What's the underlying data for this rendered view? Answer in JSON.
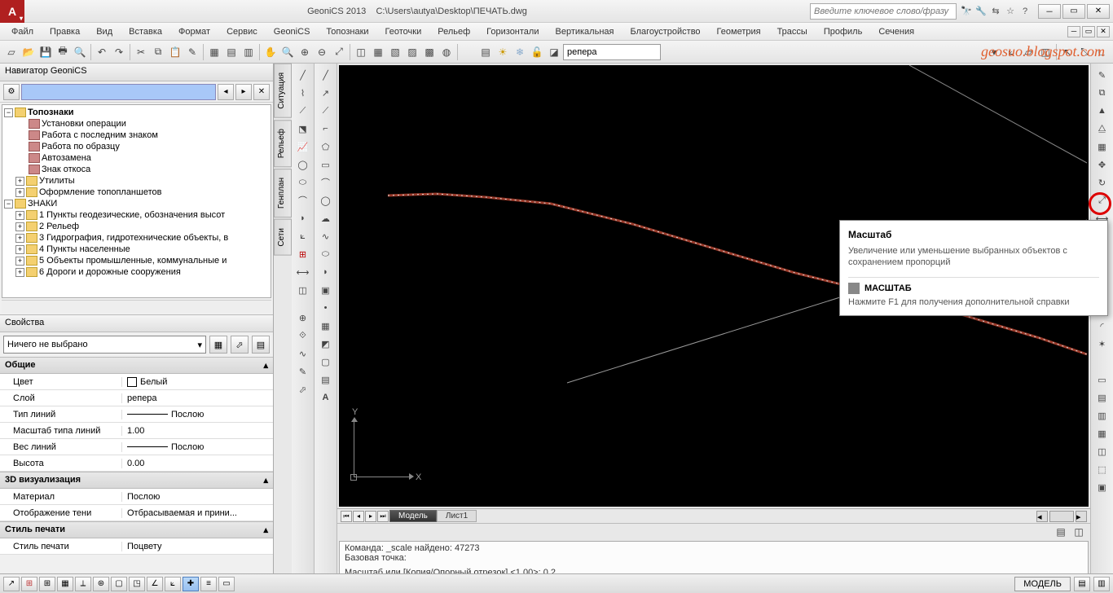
{
  "title": {
    "app": "GeoniCS 2013",
    "file": "C:\\Users\\autya\\Desktop\\ПЕЧАТЬ.dwg"
  },
  "search_placeholder": "Введите ключевое слово/фразу",
  "watermark": "geosuo.blogspot.com",
  "menu": [
    "Файл",
    "Правка",
    "Вид",
    "Вставка",
    "Формат",
    "Сервис",
    "GeoniCS",
    "Топознаки",
    "Геоточки",
    "Рельеф",
    "Горизонтали",
    "Вертикальная",
    "Благоустройство",
    "Геометрия",
    "Трассы",
    "Профиль",
    "Сечения"
  ],
  "layer_name": "репера",
  "navigator": {
    "title": "Навигатор GeoniCS",
    "tree": {
      "root": "Топознаки",
      "items": [
        "Установки операции",
        "Работа с последним знаком",
        "Работа по образцу",
        "Автозамена",
        "Знак откоса"
      ],
      "folders": [
        "Утилиты",
        "Оформление топопланшетов"
      ],
      "znaki": "ЗНАКИ",
      "znaki_items": [
        "1 Пункты геодезические, обозначения высот",
        "2 Рельеф",
        "3 Гидрография, гидротехнические объекты, в",
        "4 Пункты населенные",
        "5 Объекты промышленные, коммунальные и",
        "6 Дороги и дорожные сооружения"
      ]
    }
  },
  "vtabs": [
    "Ситуация",
    "Рельеф",
    "Генплан",
    "Сети"
  ],
  "properties": {
    "title": "Свойства",
    "selection": "Ничего не выбрано",
    "sections": {
      "general": "Общие",
      "viz3d": "3D визуализация",
      "print": "Стиль печати"
    },
    "rows": {
      "color_k": "Цвет",
      "color_v": "Белый",
      "layer_k": "Слой",
      "layer_v": "репера",
      "ltype_k": "Тип линий",
      "ltype_v": "Послою",
      "lscale_k": "Масштаб типа линий",
      "lscale_v": "1.00",
      "lweight_k": "Вес линий",
      "lweight_v": "Послою",
      "height_k": "Высота",
      "height_v": "0.00",
      "mat_k": "Материал",
      "mat_v": "Послою",
      "shadow_k": "Отображение тени",
      "shadow_v": "Отбрасываемая и прини...",
      "pstyle_k": "Стиль печати",
      "pstyle_v": "Поцвету"
    }
  },
  "tooltip": {
    "title": "Масштаб",
    "desc": "Увеличение или уменьшение выбранных объектов с сохранением пропорций",
    "cmd": "МАСШТАБ",
    "help": "Нажмите F1 для получения дополнительной справки"
  },
  "model_tabs": {
    "active": "Модель",
    "other": "Лист1"
  },
  "command": {
    "l1": "Команда: _scale найдено: 47273",
    "l2": "Базовая точка:",
    "l3": "Масштаб или  [Копия/Опорный отрезок] <1.00>: 0.2"
  },
  "ucs": {
    "x": "X",
    "y": "Y"
  },
  "status_model": "МОДЕЛЬ"
}
